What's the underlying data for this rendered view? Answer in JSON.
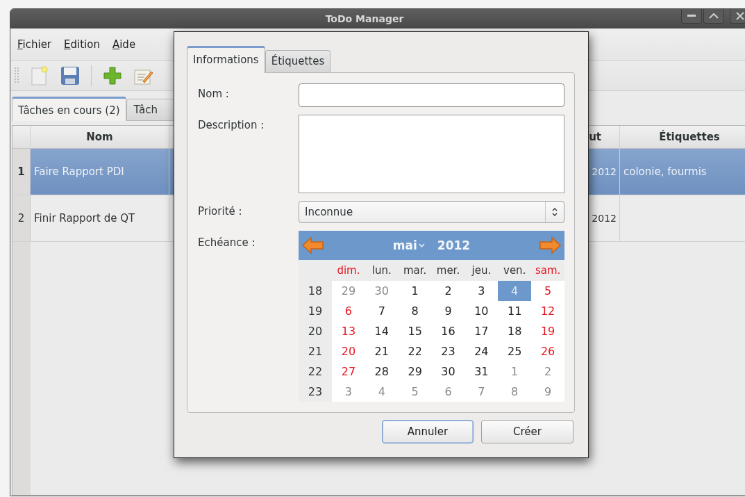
{
  "window": {
    "title": "ToDo Manager"
  },
  "menu": [
    {
      "label": "Fichier"
    },
    {
      "label": "Edition"
    },
    {
      "label": "Aide"
    }
  ],
  "main_tabs": [
    {
      "label": "Tâches en cours (2)",
      "selected": true
    },
    {
      "label": "Tâch",
      "selected": false
    }
  ],
  "table": {
    "columns": [
      {
        "label": "Nom"
      },
      {
        "label": "ut"
      },
      {
        "label": "Étiquettes"
      }
    ],
    "rows": [
      {
        "number": "1",
        "name": "Faire Rapport PDI",
        "column_4": "2012",
        "tags": "colonie, fourmis",
        "selected": true
      },
      {
        "number": "2",
        "name": "Finir Rapport de QT",
        "column_4": "2012",
        "selected": false
      }
    ]
  },
  "dialog": {
    "tabs": [
      {
        "label": "Informations",
        "selected": true
      },
      {
        "label": "Étiquettes",
        "selected": false
      }
    ],
    "name_label": "Nom :",
    "description_label": "Description :",
    "priority_label": "Priorité :",
    "priority_value": "Inconnue",
    "due_label": "Echéance :",
    "calendar": {
      "month": "mai",
      "year": "2012",
      "day_names": [
        {
          "label": "dim.",
          "weekend": true
        },
        {
          "label": "lun.",
          "weekend": false
        },
        {
          "label": "mar.",
          "weekend": false
        },
        {
          "label": "mer.",
          "weekend": false
        },
        {
          "label": "jeu.",
          "weekend": false
        },
        {
          "label": "ven.",
          "weekend": false
        },
        {
          "label": "sam.",
          "weekend": true
        }
      ],
      "weeks": [
        {
          "number": "18",
          "days": [
            {
              "label": "29",
              "outside": true,
              "selected": false
            },
            {
              "label": "30",
              "outside": true,
              "selected": false
            },
            {
              "label": "1",
              "outside": false,
              "selected": false
            },
            {
              "label": "2",
              "outside": false,
              "selected": false
            },
            {
              "label": "3",
              "outside": false,
              "selected": false
            },
            {
              "label": "4",
              "outside": false,
              "selected": true
            },
            {
              "label": "5",
              "outside": false,
              "selected": false
            }
          ]
        },
        {
          "number": "19",
          "days": [
            {
              "label": "6",
              "outside": false,
              "selected": false
            },
            {
              "label": "7",
              "outside": false,
              "selected": false
            },
            {
              "label": "8",
              "outside": false,
              "selected": false
            },
            {
              "label": "9",
              "outside": false,
              "selected": false
            },
            {
              "label": "10",
              "outside": false,
              "selected": false
            },
            {
              "label": "11",
              "outside": false,
              "selected": false
            },
            {
              "label": "12",
              "outside": false,
              "selected": false
            }
          ]
        },
        {
          "number": "20",
          "days": [
            {
              "label": "13",
              "outside": false,
              "selected": false
            },
            {
              "label": "14",
              "outside": false,
              "selected": false
            },
            {
              "label": "15",
              "outside": false,
              "selected": false
            },
            {
              "label": "16",
              "outside": false,
              "selected": false
            },
            {
              "label": "17",
              "outside": false,
              "selected": false
            },
            {
              "label": "18",
              "outside": false,
              "selected": false
            },
            {
              "label": "19",
              "outside": false,
              "selected": false
            }
          ]
        },
        {
          "number": "21",
          "days": [
            {
              "label": "20",
              "outside": false,
              "selected": false
            },
            {
              "label": "21",
              "outside": false,
              "selected": false
            },
            {
              "label": "22",
              "outside": false,
              "selected": false
            },
            {
              "label": "23",
              "outside": false,
              "selected": false
            },
            {
              "label": "24",
              "outside": false,
              "selected": false
            },
            {
              "label": "25",
              "outside": false,
              "selected": false
            },
            {
              "label": "26",
              "outside": false,
              "selected": false
            }
          ]
        },
        {
          "number": "22",
          "days": [
            {
              "label": "27",
              "outside": false,
              "selected": false
            },
            {
              "label": "28",
              "outside": false,
              "selected": false
            },
            {
              "label": "29",
              "outside": false,
              "selected": false
            },
            {
              "label": "30",
              "outside": false,
              "selected": false
            },
            {
              "label": "31",
              "outside": false,
              "selected": false
            },
            {
              "label": "1",
              "outside": true,
              "selected": false
            },
            {
              "label": "2",
              "outside": true,
              "selected": false
            }
          ]
        },
        {
          "number": "23",
          "days": [
            {
              "label": "3",
              "outside": true,
              "selected": false
            },
            {
              "label": "4",
              "outside": true,
              "selected": false
            },
            {
              "label": "5",
              "outside": true,
              "selected": false
            },
            {
              "label": "6",
              "outside": true,
              "selected": false
            },
            {
              "label": "7",
              "outside": true,
              "selected": false
            },
            {
              "label": "8",
              "outside": true,
              "selected": false
            },
            {
              "label": "9",
              "outside": true,
              "selected": false
            }
          ]
        }
      ]
    },
    "buttons": [
      {
        "label": "Annuler",
        "focused": true
      },
      {
        "label": "Créer",
        "focused": false
      }
    ]
  }
}
